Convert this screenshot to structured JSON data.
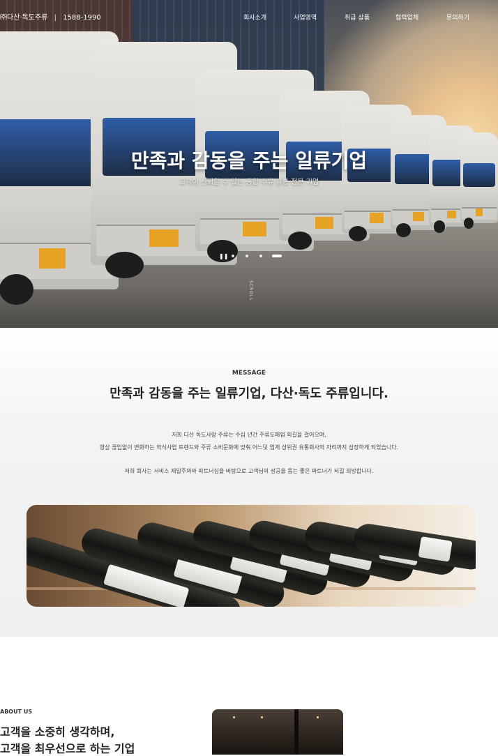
{
  "header": {
    "logo_text": "㈜다산·독도주류",
    "logo_separator": "|",
    "phone": "1588-1990",
    "menu": [
      "회사소개",
      "사업영역",
      "취급 상품",
      "협력업체",
      "문의하기"
    ]
  },
  "hero": {
    "title": "만족과 감동을 주는 일류기업",
    "subtitle": "고객이 신뢰할 수 있는 종합 주류 유통 전문 기업",
    "pause_icon": "pause-icon",
    "slide_count": 5,
    "active_slide": 5,
    "scroll_label": "SCROLL"
  },
  "message": {
    "label": "MESSAGE",
    "title": "만족과 감동을 주는 일류기업, 다산·독도 주류입니다.",
    "paragraph1_line1": "저희 다산 독도사랑 주류는 수십 년간 주류도매업 외길을 걸어오며,",
    "paragraph1_line2": "항상 끊임없이 변화하는 외식사업 트렌드와 주류 소비문화에 맞춰 어느덧 업계 상위권 유통회사의 자리까지 성장하게 되었습니다.",
    "paragraph2": "저희 회사는 서비스 제일주의와 파트너십을 바탕으로 고객님의 성공을 돕는 좋은 파트너가 되길 희망합니다."
  },
  "about": {
    "label": "ABOUT US",
    "title_line1": "고객을 소중히 생각하며,",
    "title_line2": "고객을 최우선으로 하는 기업"
  },
  "colors": {
    "accent_plate": "#e6a323",
    "section_bg": "#f0f0f0"
  }
}
